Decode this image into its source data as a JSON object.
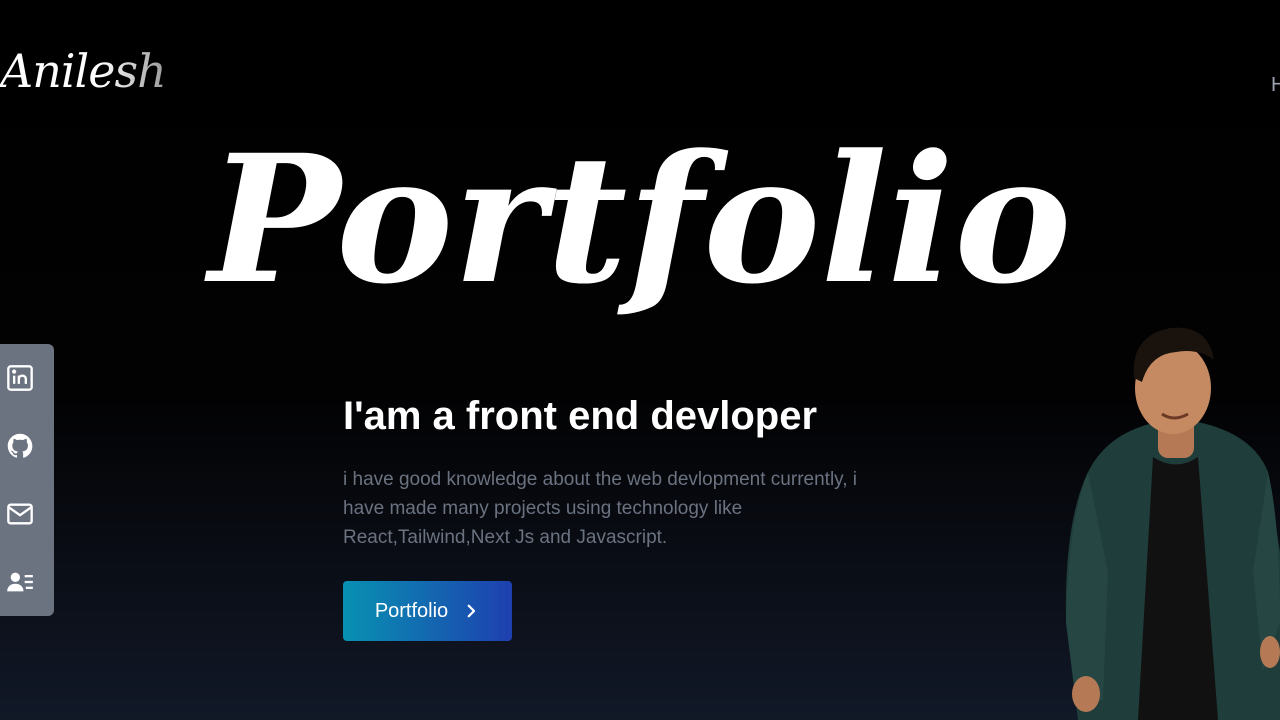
{
  "header": {
    "logo_text": "Anilesh",
    "nav_peek_text": "H"
  },
  "hero": {
    "title": "Portfolio",
    "subtitle": "I'am a front end devloper",
    "description": "i have good knowledge about the web devlopment currently, i have made many projects using technology like React,Tailwind,Next Js and Javascript.",
    "cta_label": "Portfolio",
    "cta_icon": "chevron-right-icon"
  },
  "social_links": [
    {
      "name": "linkedin",
      "icon": "linkedin-icon"
    },
    {
      "name": "github",
      "icon": "github-icon"
    },
    {
      "name": "email",
      "icon": "mail-icon"
    },
    {
      "name": "resume",
      "icon": "user-card-icon"
    }
  ],
  "colors": {
    "background": "#000000",
    "social_bar": "#6b7280",
    "description_text": "#6b7280",
    "button_gradient_start": "#0891b2",
    "button_gradient_end": "#1e40af"
  }
}
